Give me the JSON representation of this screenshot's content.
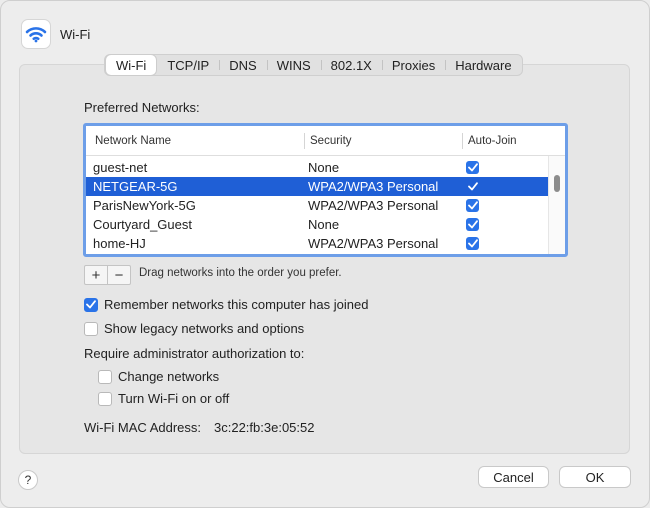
{
  "header": {
    "title": "Wi-Fi",
    "icon": "wifi-icon"
  },
  "tabs": [
    {
      "label": "Wi-Fi",
      "selected": true
    },
    {
      "label": "TCP/IP",
      "selected": false
    },
    {
      "label": "DNS",
      "selected": false
    },
    {
      "label": "WINS",
      "selected": false
    },
    {
      "label": "802.1X",
      "selected": false
    },
    {
      "label": "Proxies",
      "selected": false
    },
    {
      "label": "Hardware",
      "selected": false
    }
  ],
  "preferred": {
    "label": "Preferred Networks:",
    "columns": {
      "name": "Network Name",
      "security": "Security",
      "autojoin": "Auto-Join"
    },
    "rows": [
      {
        "name": "guest-net",
        "security": "None",
        "autojoin": true,
        "selected": false
      },
      {
        "name": "NETGEAR-5G",
        "security": "WPA2/WPA3 Personal",
        "autojoin": true,
        "selected": true
      },
      {
        "name": "ParisNewYork-5G",
        "security": "WPA2/WPA3 Personal",
        "autojoin": true,
        "selected": false
      },
      {
        "name": "Courtyard_Guest",
        "security": "None",
        "autojoin": true,
        "selected": false
      },
      {
        "name": "home-HJ",
        "security": "WPA2/WPA3 Personal",
        "autojoin": true,
        "selected": false
      }
    ],
    "add_label": "+",
    "remove_label": "−",
    "drag_hint": "Drag networks into the order you prefer."
  },
  "options": {
    "remember": {
      "label": "Remember networks this computer has joined",
      "checked": true
    },
    "legacy": {
      "label": "Show legacy networks and options",
      "checked": false
    },
    "admin_label": "Require administrator authorization to:",
    "change_networks": {
      "label": "Change networks",
      "checked": false
    },
    "turn_wifi": {
      "label": "Turn Wi-Fi on or off",
      "checked": false
    }
  },
  "mac": {
    "label": "Wi-Fi MAC Address:",
    "value": "3c:22:fb:3e:05:52"
  },
  "footer": {
    "help_label": "?",
    "cancel_label": "Cancel",
    "ok_label": "OK"
  },
  "colors": {
    "accent": "#2a73e8",
    "selection": "#1f5fd6",
    "focus_ring": "#6d9ee8"
  }
}
